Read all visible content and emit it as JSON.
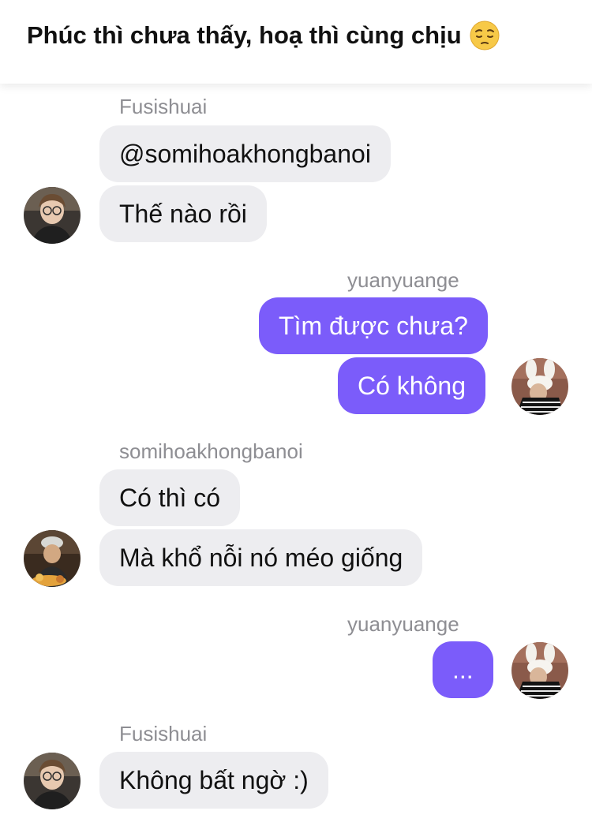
{
  "header": {
    "title": "Phúc thì chưa thấy, hoạ thì cùng chịu",
    "emoji_icon": "pensive-face-emoji"
  },
  "messages": [
    {
      "sender": "Fusishuai",
      "lines": [
        "@somihoakhongbanoi",
        "Thế nào rồi"
      ]
    },
    {
      "sender": "yuanyuange",
      "lines": [
        "Tìm được chưa?",
        "Có không"
      ]
    },
    {
      "sender": "somihoakhongbanoi",
      "lines": [
        "Có thì có",
        "Mà khổ nỗi nó méo giống"
      ]
    },
    {
      "sender": "yuanyuange",
      "lines": [
        "..."
      ]
    },
    {
      "sender": "Fusishuai",
      "lines": [
        "Không bất ngờ :)"
      ]
    }
  ],
  "colors": {
    "outgoing_bubble": "#7b5cfa",
    "incoming_bubble": "#ededf0",
    "sender_label": "#8e8e93"
  }
}
